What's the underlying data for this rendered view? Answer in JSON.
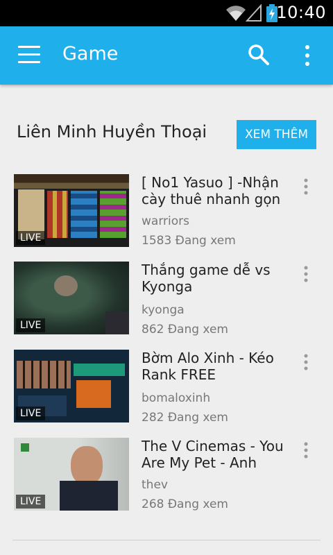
{
  "status_bar": {
    "time": "10:40",
    "icons": [
      "wifi-icon",
      "signal-icon",
      "battery-charging-icon"
    ]
  },
  "app_bar": {
    "title": "Game",
    "icons": [
      "menu-icon",
      "search-icon",
      "more-vert-icon"
    ]
  },
  "section": {
    "title": "Liên Minh Huyền Thoại",
    "more_button": "XEM THÊM"
  },
  "videos": [
    {
      "title": "[ No1 Yasuo ] -Nhận cày thuê nhanh gọn",
      "channel": "warriors",
      "viewers": "1583 Đang xem",
      "badge": "LIVE"
    },
    {
      "title": "Thắng game dễ vs Kyonga",
      "channel": "kyonga",
      "viewers": "862 Đang xem",
      "badge": "LIVE"
    },
    {
      "title": "Bờm Alo Xinh - Kéo Rank FREE",
      "channel": "bomaloxinh",
      "viewers": "282 Đang xem",
      "badge": "LIVE"
    },
    {
      "title": "The V Cinemas - You Are My Pet - Anh",
      "channel": "thev",
      "viewers": "268 Đang xem",
      "badge": "LIVE"
    }
  ],
  "colors": {
    "accent": "#1fb0ec",
    "background": "#eeeeee",
    "status_bar": "#000000"
  }
}
